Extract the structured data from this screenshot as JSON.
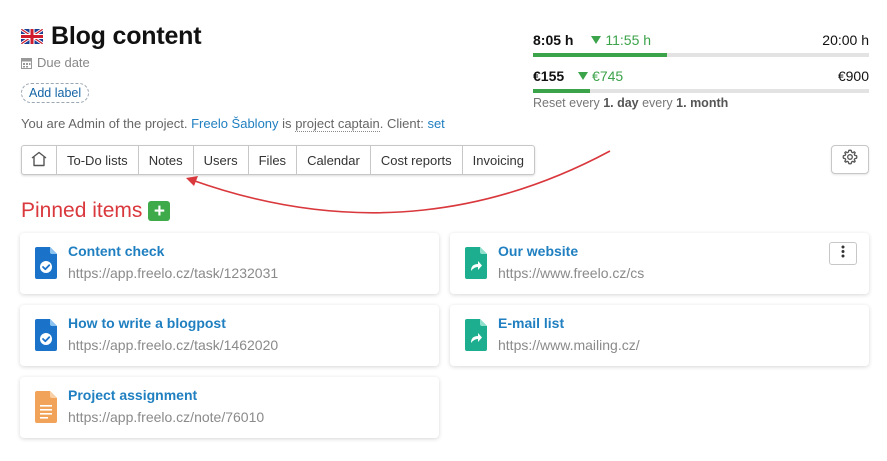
{
  "header": {
    "flag_icon": "uk-flag-icon",
    "title": "Blog content",
    "due_date": "Due date",
    "add_label": "Add label"
  },
  "admin_line": {
    "prefix": "You are Admin of the project.",
    "captain_name": "Freelo Šablony",
    "is": "is",
    "captain_role": "project captain",
    "client_label": ". Client:",
    "client_link": "set"
  },
  "tabs": [
    {
      "label": "To-Do lists"
    },
    {
      "label": "Notes"
    },
    {
      "label": "Users"
    },
    {
      "label": "Files"
    },
    {
      "label": "Calendar"
    },
    {
      "label": "Cost reports"
    },
    {
      "label": "Invoicing"
    }
  ],
  "budget": {
    "time": {
      "spent": "8:05 h",
      "estimate": "11:55 h",
      "total": "20:00 h",
      "progress": 0.4
    },
    "money": {
      "spent": "€155",
      "estimate": "€745",
      "total": "€900",
      "progress": 0.17
    },
    "reset": {
      "prefix": "Reset every",
      "day": "1. day",
      "middle": "every",
      "month": "1. month"
    }
  },
  "pinned": {
    "title": "Pinned items",
    "add_symbol": "+",
    "items": [
      {
        "title": "Content check",
        "url": "https://app.freelo.cz/task/1232031",
        "icon": "task-file-icon"
      },
      {
        "title": "Our website",
        "url": "https://www.freelo.cz/cs",
        "icon": "link-file-icon"
      },
      {
        "title": "How to write a blogpost",
        "url": "https://app.freelo.cz/task/1462020",
        "icon": "task-file-icon"
      },
      {
        "title": "E-mail list",
        "url": "https://www.mailing.cz/",
        "icon": "link-file-icon"
      },
      {
        "title": "Project assignment",
        "url": "https://app.freelo.cz/note/76010",
        "icon": "note-file-icon"
      }
    ]
  },
  "colors": {
    "accent_link": "#1f7fc0",
    "pinned_title": "#d9383d",
    "progress": "#3ba34a",
    "task_icon": "#1a73c9",
    "link_icon": "#1cae8e",
    "note_icon": "#f2a35a",
    "annotation_arrow": "#d9383d"
  }
}
